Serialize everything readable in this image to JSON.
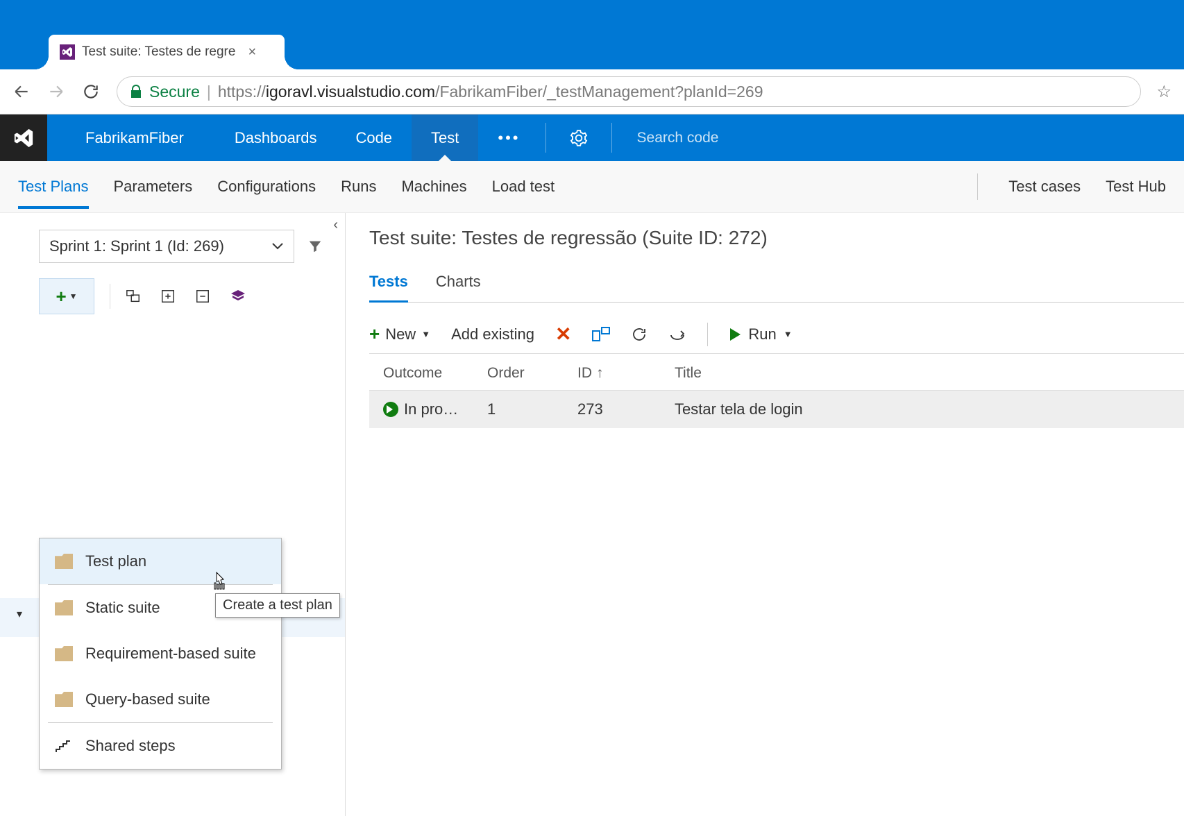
{
  "browser": {
    "tab_title": "Test suite: Testes de regre",
    "secure_label": "Secure",
    "url_prefix": "https://",
    "url_host": "igoravl.visualstudio.com",
    "url_path": "/FabrikamFiber/_testManagement?planId=269"
  },
  "header": {
    "project_name": "FabrikamFiber",
    "hubs": [
      "Dashboards",
      "Code",
      "Test"
    ],
    "active_hub": "Test",
    "search_placeholder": "Search code"
  },
  "subnav": {
    "left": [
      "Test Plans",
      "Parameters",
      "Configurations",
      "Runs",
      "Machines",
      "Load test"
    ],
    "right": [
      "Test cases",
      "Test Hub"
    ],
    "active": "Test Plans"
  },
  "left": {
    "plan_selector": "Sprint 1: Sprint 1 (Id: 269)",
    "dropdown": {
      "items": [
        "Test plan",
        "Static suite",
        "Requirement-based suite",
        "Query-based suite"
      ],
      "footer": "Shared steps",
      "highlight": "Test plan"
    },
    "tooltip": "Create a test plan"
  },
  "right": {
    "suite_title": "Test suite: Testes de regressão (Suite ID: 272)",
    "inner_tabs": [
      "Tests",
      "Charts"
    ],
    "active_inner_tab": "Tests",
    "toolbar": {
      "new_label": "New",
      "add_existing": "Add existing",
      "run_label": "Run"
    },
    "columns": [
      "Outcome",
      "Order",
      "ID",
      "Title"
    ],
    "sort_column": "ID",
    "rows": [
      {
        "outcome": "In pro…",
        "order": "1",
        "id": "273",
        "title": "Testar tela de login"
      }
    ]
  }
}
